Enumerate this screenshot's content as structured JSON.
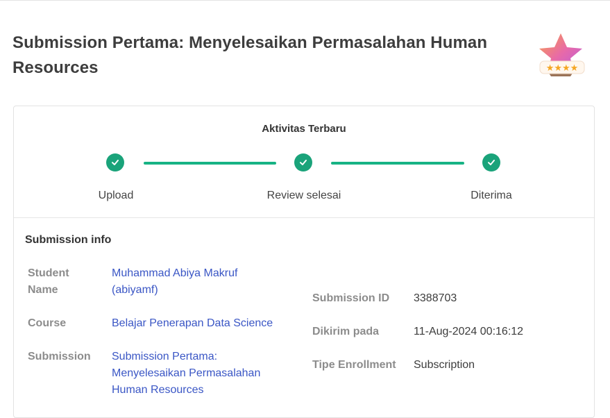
{
  "page": {
    "title": "Submission Pertama: Menyelesaikan Permasalahan Human Resources",
    "badge_icon": "four-star-badge-icon"
  },
  "activity": {
    "title": "Aktivitas Terbaru",
    "accent_color": "#1aa37a",
    "steps": [
      {
        "label": "Upload",
        "icon": "check-icon",
        "done": true
      },
      {
        "label": "Review selesai",
        "icon": "check-icon",
        "done": true
      },
      {
        "label": "Diterima",
        "icon": "check-icon",
        "done": true
      }
    ]
  },
  "info": {
    "title": "Submission info",
    "left": [
      {
        "label": "Student Name",
        "value": "Muhammad Abiya Makruf (abiyamf)"
      },
      {
        "label": "Course",
        "value": "Belajar Penerapan Data Science"
      },
      {
        "label": "Submission",
        "value": "Submission Pertama: Menyelesaikan Permasalahan Human Resources"
      }
    ],
    "right": [
      {
        "label": "Submission ID",
        "value": "3388703"
      },
      {
        "label": "Dikirim pada",
        "value": "11-Aug-2024 00:16:12"
      },
      {
        "label": "Tipe Enrollment",
        "value": "Subscription"
      }
    ],
    "link_color": "#3a56c5"
  }
}
